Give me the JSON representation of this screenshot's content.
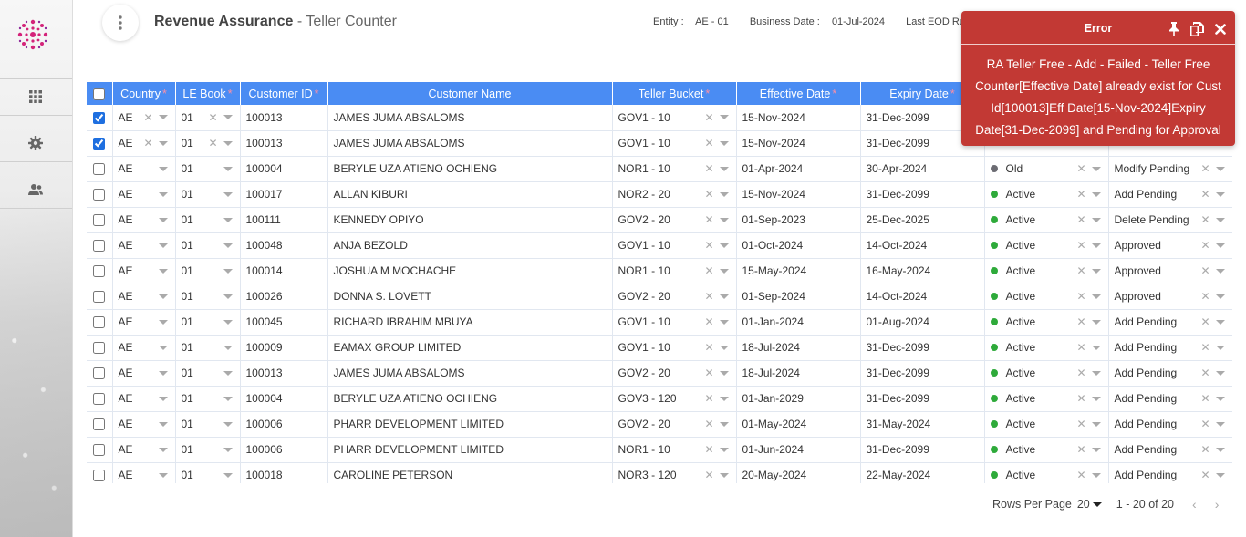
{
  "header": {
    "app_title": "Revenue Assurance",
    "page_title": "- Teller Counter",
    "entity_label": "Entity :",
    "entity_value": "AE - 01",
    "business_date_label": "Business Date :",
    "business_date_value": "01-Jul-2024",
    "last_eod_label": "Last EOD Run Date"
  },
  "sidebar": {
    "items": [
      {
        "icon": "grid-icon"
      },
      {
        "icon": "gear-icon"
      },
      {
        "icon": "users-icon"
      }
    ]
  },
  "table": {
    "columns": [
      "Country",
      "LE Book",
      "Customer ID",
      "Customer Name",
      "Teller Bucket",
      "Effective Date",
      "Expiry Date"
    ],
    "required_marker": "*",
    "rows": [
      {
        "checked": true,
        "country": "AE",
        "lebook": "01",
        "cid": "100013",
        "name": "JAMES JUMA ABSALOMS",
        "bucket": "GOV1 - 10",
        "eff": "15-Nov-2024",
        "exp": "31-Dec-2099",
        "status": "",
        "record": ""
      },
      {
        "checked": true,
        "country": "AE",
        "lebook": "01",
        "cid": "100013",
        "name": "JAMES JUMA ABSALOMS",
        "bucket": "GOV1 - 10",
        "eff": "15-Nov-2024",
        "exp": "31-Dec-2099",
        "status": "",
        "record": ""
      },
      {
        "checked": false,
        "country": "AE",
        "lebook": "01",
        "cid": "100004",
        "name": "BERYLE UZA ATIENO OCHIENG",
        "bucket": "NOR1 - 10",
        "eff": "01-Apr-2024",
        "exp": "30-Apr-2024",
        "status": "Old",
        "record": "Modify Pending"
      },
      {
        "checked": false,
        "country": "AE",
        "lebook": "01",
        "cid": "100017",
        "name": "ALLAN KIBURI",
        "bucket": "NOR2 - 20",
        "eff": "15-Nov-2024",
        "exp": "31-Dec-2099",
        "status": "Active",
        "record": "Add Pending"
      },
      {
        "checked": false,
        "country": "AE",
        "lebook": "01",
        "cid": "100111",
        "name": "KENNEDY OPIYO",
        "bucket": "GOV2 - 20",
        "eff": "01-Sep-2023",
        "exp": "25-Dec-2025",
        "status": "Active",
        "record": "Delete Pending"
      },
      {
        "checked": false,
        "country": "AE",
        "lebook": "01",
        "cid": "100048",
        "name": "ANJA BEZOLD",
        "bucket": "GOV1 - 10",
        "eff": "01-Oct-2024",
        "exp": "14-Oct-2024",
        "status": "Active",
        "record": "Approved"
      },
      {
        "checked": false,
        "country": "AE",
        "lebook": "01",
        "cid": "100014",
        "name": "JOSHUA M MOCHACHE",
        "bucket": "NOR1 - 10",
        "eff": "15-May-2024",
        "exp": "16-May-2024",
        "status": "Active",
        "record": "Approved"
      },
      {
        "checked": false,
        "country": "AE",
        "lebook": "01",
        "cid": "100026",
        "name": "DONNA S. LOVETT",
        "bucket": "GOV2 - 20",
        "eff": "01-Sep-2024",
        "exp": "14-Oct-2024",
        "status": "Active",
        "record": "Approved"
      },
      {
        "checked": false,
        "country": "AE",
        "lebook": "01",
        "cid": "100045",
        "name": "RICHARD IBRAHIM MBUYA",
        "bucket": "GOV1 - 10",
        "eff": "01-Jan-2024",
        "exp": "01-Aug-2024",
        "status": "Active",
        "record": "Add Pending"
      },
      {
        "checked": false,
        "country": "AE",
        "lebook": "01",
        "cid": "100009",
        "name": "EAMAX GROUP LIMITED",
        "bucket": "GOV1 - 10",
        "eff": "18-Jul-2024",
        "exp": "31-Dec-2099",
        "status": "Active",
        "record": "Add Pending"
      },
      {
        "checked": false,
        "country": "AE",
        "lebook": "01",
        "cid": "100013",
        "name": "JAMES JUMA ABSALOMS",
        "bucket": "GOV2 - 20",
        "eff": "18-Jul-2024",
        "exp": "31-Dec-2099",
        "status": "Active",
        "record": "Add Pending"
      },
      {
        "checked": false,
        "country": "AE",
        "lebook": "01",
        "cid": "100004",
        "name": "BERYLE UZA ATIENO OCHIENG",
        "bucket": "GOV3 - 120",
        "eff": "01-Jan-2029",
        "exp": "31-Dec-2099",
        "status": "Active",
        "record": "Add Pending"
      },
      {
        "checked": false,
        "country": "AE",
        "lebook": "01",
        "cid": "100006",
        "name": "PHARR DEVELOPMENT LIMITED",
        "bucket": "GOV2 - 20",
        "eff": "01-May-2024",
        "exp": "31-May-2024",
        "status": "Active",
        "record": "Add Pending"
      },
      {
        "checked": false,
        "country": "AE",
        "lebook": "01",
        "cid": "100006",
        "name": "PHARR DEVELOPMENT LIMITED",
        "bucket": "NOR1 - 10",
        "eff": "01-Jun-2024",
        "exp": "31-Dec-2099",
        "status": "Active",
        "record": "Add Pending"
      },
      {
        "checked": false,
        "country": "AE",
        "lebook": "01",
        "cid": "100018",
        "name": "CAROLINE PETERSON",
        "bucket": "NOR3 - 120",
        "eff": "20-May-2024",
        "exp": "22-May-2024",
        "status": "Active",
        "record": "Add Pending"
      }
    ]
  },
  "footer": {
    "rows_per_page_label": "Rows Per Page",
    "rows_per_page_value": "20",
    "range_text": "1 - 20 of 20"
  },
  "error": {
    "title": "Error",
    "message": "RA Teller Free - Add - Failed - Teller Free Counter[Effective Date] already exist for Cust Id[100013]Eff Date[15-Nov-2024]Expiry Date[31-Dec-2099] and Pending for Approval"
  },
  "colors": {
    "header_blue": "#4a8cf3",
    "error_red": "#c23934",
    "active_green": "#2eaa3a",
    "old_grey": "#6b6b72",
    "required_pink": "#ff8fa3"
  }
}
